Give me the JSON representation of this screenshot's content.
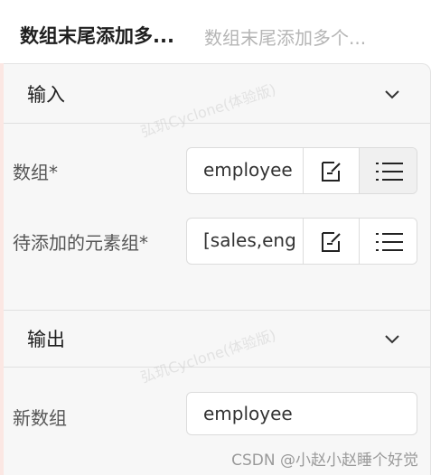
{
  "header": {
    "title": "数组末尾添加多...",
    "subtitle": "数组末尾添加多个..."
  },
  "input_section": {
    "title": "输入",
    "fields": [
      {
        "label": "数组*",
        "value": "employee"
      },
      {
        "label": "待添加的元素组*",
        "value": "[sales,eng"
      }
    ]
  },
  "output_section": {
    "title": "输出",
    "fields": [
      {
        "label": "新数组",
        "value": "employee"
      }
    ]
  },
  "watermark": "弘玑Cyclone(体验版)",
  "footer_watermark": "CSDN @小赵小赵睡个好觉",
  "icons": {
    "edit": "edit-icon",
    "list": "list-icon",
    "chevron": "chevron-down-icon"
  }
}
